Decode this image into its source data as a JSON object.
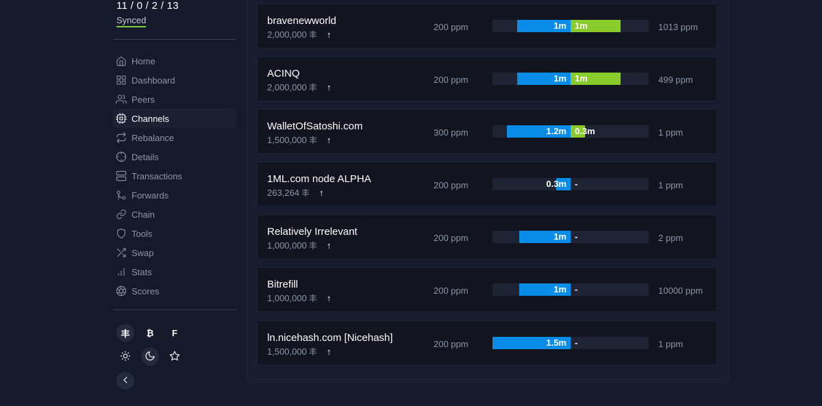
{
  "sidebar": {
    "node_stats": "11 / 0 / 2 / 13",
    "sync_status": "Synced",
    "nav": [
      {
        "label": "Home",
        "icon": "home-icon"
      },
      {
        "label": "Dashboard",
        "icon": "dashboard-icon"
      },
      {
        "label": "Peers",
        "icon": "users-icon"
      },
      {
        "label": "Channels",
        "icon": "cpu-icon",
        "active": true
      },
      {
        "label": "Rebalance",
        "icon": "repeat-icon"
      },
      {
        "label": "Details",
        "icon": "crosshair-icon"
      },
      {
        "label": "Transactions",
        "icon": "server-icon"
      },
      {
        "label": "Forwards",
        "icon": "git-merge-icon"
      },
      {
        "label": "Chain",
        "icon": "link-icon"
      },
      {
        "label": "Tools",
        "icon": "shield-icon"
      },
      {
        "label": "Swap",
        "icon": "shuffle-icon"
      },
      {
        "label": "Stats",
        "icon": "bar-chart-icon"
      },
      {
        "label": "Scores",
        "icon": "aperture-icon"
      }
    ],
    "currency_buttons": [
      "丰",
      "₿",
      "F"
    ],
    "theme_icons": [
      "sun-icon",
      "moon-icon",
      "star-icon"
    ],
    "collapse_icon": "chevron-left-icon"
  },
  "channels": [
    {
      "name": "bravenewworld",
      "capacity": "2,000,000",
      "unit": "丰",
      "fee": "200 ppm",
      "local": 0.34,
      "remote": 0.32,
      "local_label": "1m",
      "remote_label": "1m",
      "remote_fee": "1013 ppm"
    },
    {
      "name": "ACINQ",
      "capacity": "2,000,000",
      "unit": "丰",
      "fee": "200 ppm",
      "local": 0.34,
      "remote": 0.32,
      "local_label": "1m",
      "remote_label": "1m",
      "remote_fee": "499 ppm"
    },
    {
      "name": "WalletOfSatoshi.com",
      "capacity": "1,500,000",
      "unit": "丰",
      "fee": "300 ppm",
      "local": 0.41,
      "remote": 0.09,
      "local_label": "1.2m",
      "remote_label": "0.3m",
      "remote_fee": "1 ppm"
    },
    {
      "name": "1ML.com node ALPHA",
      "capacity": "263,264",
      "unit": "丰",
      "fee": "200 ppm",
      "local": 0.09,
      "remote": 0,
      "local_label": "0.3m",
      "remote_label": "-",
      "remote_fee": "1 ppm"
    },
    {
      "name": "Relatively Irrelevant",
      "capacity": "1,000,000",
      "unit": "丰",
      "fee": "200 ppm",
      "local": 0.33,
      "remote": 0,
      "local_label": "1m",
      "remote_label": "-",
      "remote_fee": "2 ppm"
    },
    {
      "name": "Bitrefill",
      "capacity": "1,000,000",
      "unit": "丰",
      "fee": "200 ppm",
      "local": 0.33,
      "remote": 0,
      "local_label": "1m",
      "remote_label": "-",
      "remote_fee": "10000 ppm"
    },
    {
      "name": "ln.nicehash.com [Nicehash]",
      "capacity": "1,500,000",
      "unit": "丰",
      "fee": "200 ppm",
      "local": 0.5,
      "remote": 0,
      "local_label": "1.5m",
      "remote_label": "-",
      "remote_fee": "1 ppm"
    }
  ],
  "colors": {
    "local": "#0a8de8",
    "remote": "#8acb2c",
    "synced_underline": "#7cd23c"
  }
}
